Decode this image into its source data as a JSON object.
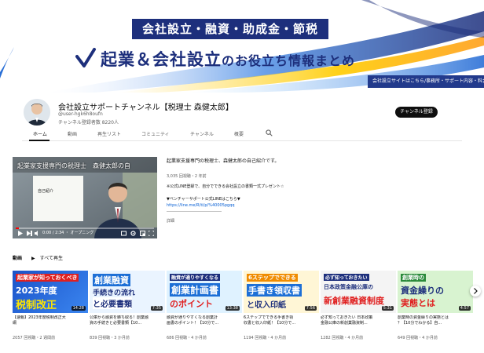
{
  "banner": {
    "top_text": "会社設立・融資・助成金・節税",
    "main_text_a": "起業＆会社設立",
    "main_text_b": "のお役立ち情報まとめ",
    "corner_text": "会社設立サイトはこちら/事務所・サポート内容・料金の詳細",
    "colors": {
      "navy": "#1d2f7c",
      "blue": "#2a6fd6"
    }
  },
  "channel": {
    "name": "会社設立サポートチャンネル【税理士 森健太郎】",
    "handle": "@user-hgk6h8oufn",
    "subscribers": "チャンネル登録者数 8220人",
    "subscribe_label": "チャンネル登録"
  },
  "tabs": [
    "ホーム",
    "動画",
    "再生リスト",
    "コミュニティ",
    "チャンネル",
    "概要"
  ],
  "featured": {
    "overlay_title": "起業家支援専門の税理士　森健太郎の自",
    "inner_label": "自己紹介",
    "time": "0:00 / 2:34 ・ オープニング",
    "progress": 0.02
  },
  "description": {
    "title": "起業家支援専門の税理士、森健太郎の自己紹介です。",
    "stats": "3,035 回視聴・2 年前",
    "lines": [
      "※公式LINE登録で、自分でできる会社設立の書類一式プレゼント☆"
    ],
    "venture_line": "▼ベンチャーサポート公式LINEはこちら▼",
    "link": "https://line.me/R/ti/p/%40005pgqq",
    "separator": "――――――――――――――",
    "more": "詳細"
  },
  "section": {
    "title": "動画",
    "play_all": "▶　すべて再生"
  },
  "videos": [
    {
      "thumb_lines": [
        "起業家が知っておくべき",
        "2023年度",
        "税制改正"
      ],
      "duration": "14:28",
      "title_lines": [
        "【速報】2023年度税制改正大",
        "綱"
      ],
      "meta": "2057 回視聴・2 週間前"
    },
    {
      "thumb_lines": [
        "創業融資",
        "手続きの流れ",
        "と必要書類"
      ],
      "duration": "7:35",
      "title_lines": [
        "公庫から融資を勝ち取る！創業融",
        "資の手続きと必要書類【10..."
      ],
      "meta": "839 回視聴・3 か月前"
    },
    {
      "thumb_lines": [
        "融資が通りやすくなる",
        "創業計画書",
        "のポイント"
      ],
      "duration": "13:38",
      "title_lines": [
        "融資が通りやすくなる創業計",
        "画書のポイント！【10分で..."
      ],
      "meta": "686 回視聴・4 か月前"
    },
    {
      "thumb_lines": [
        "6ステップでできる",
        "手書き領収書",
        "と収入印紙"
      ],
      "duration": "7:56",
      "title_lines": [
        "6ステップでできる手書き領",
        "収書と収入印紙！【10分で..."
      ],
      "meta": "1194 回視聴・4 か月前"
    },
    {
      "thumb_lines": [
        "必ず知っておきたい",
        "日本政策金融公庫の",
        "新創業融資制度"
      ],
      "duration": "5:31",
      "title_lines": [
        "必ず知っておきたい 日本政策",
        "金融公庫の新創業融資制..."
      ],
      "meta": "1282 回視聴・4 か月前"
    },
    {
      "thumb_lines": [
        "創業時の",
        "資金繰りの",
        "実態とは"
      ],
      "duration": "4:57",
      "title_lines": [
        "創業時の資金繰りの実態とは",
        "？【10分でわかる】自..."
      ],
      "meta": "649 回視聴・4 か月前"
    }
  ]
}
